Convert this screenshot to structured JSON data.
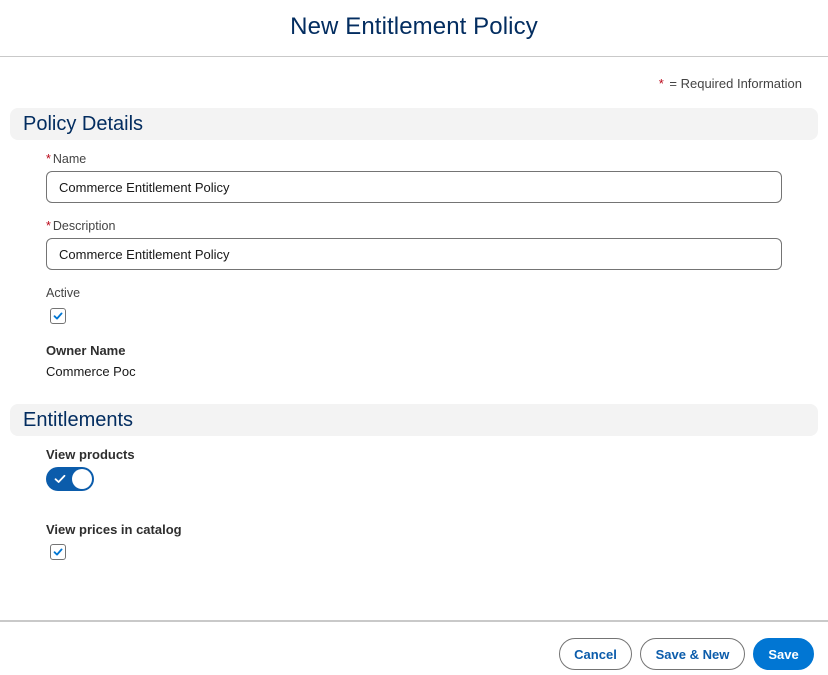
{
  "modal": {
    "title": "New Entitlement Policy"
  },
  "required_info": {
    "star": "*",
    "text": "= Required Information"
  },
  "sections": {
    "policy_details": {
      "title": "Policy Details",
      "name": {
        "required_mark": "*",
        "label": "Name",
        "value": "Commerce Entitlement Policy"
      },
      "description": {
        "required_mark": "*",
        "label": "Description",
        "value": "Commerce Entitlement Policy"
      },
      "active": {
        "label": "Active",
        "checked": true
      },
      "owner": {
        "label": "Owner Name",
        "value": "Commerce Poc"
      }
    },
    "entitlements": {
      "title": "Entitlements",
      "view_products": {
        "label": "View products",
        "enabled": true
      },
      "view_prices": {
        "label": "View prices in catalog",
        "checked": true
      }
    }
  },
  "footer": {
    "cancel_label": "Cancel",
    "save_new_label": "Save & New",
    "save_label": "Save"
  },
  "colors": {
    "brand": "#0176d3",
    "title": "#032d60",
    "required": "#ba0517",
    "toggle_on": "#0b5cab"
  }
}
